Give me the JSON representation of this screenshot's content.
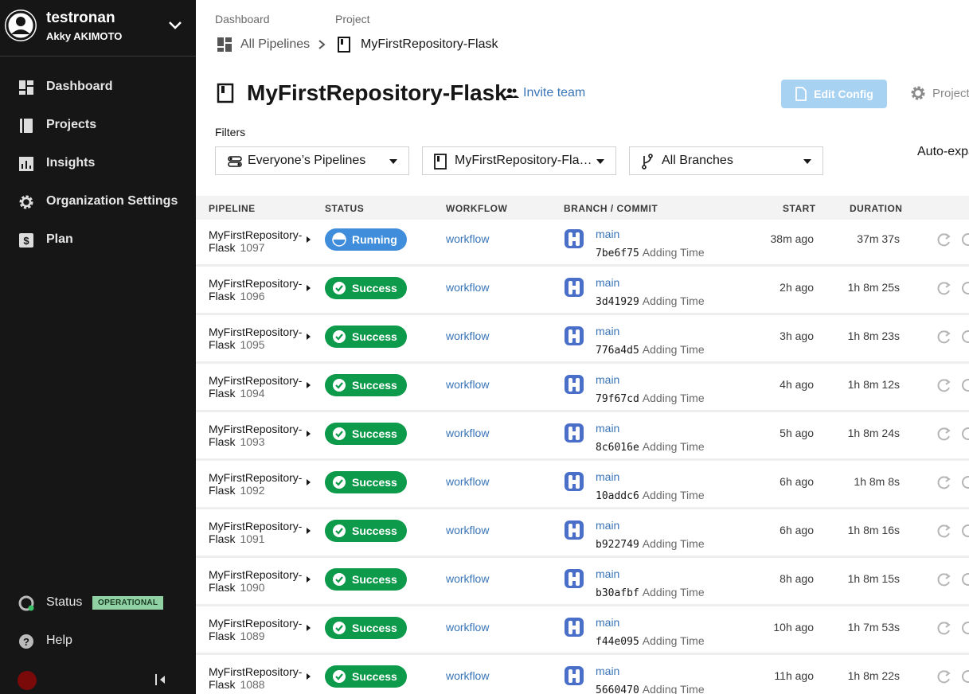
{
  "org": {
    "name": "testronan",
    "user": "Akky AKIMOTO"
  },
  "nav": [
    {
      "label": "Dashboard",
      "icon": "dashboard-icon"
    },
    {
      "label": "Projects",
      "icon": "projects-icon"
    },
    {
      "label": "Insights",
      "icon": "insights-icon"
    },
    {
      "label": "Organization Settings",
      "icon": "gear-icon"
    },
    {
      "label": "Plan",
      "icon": "dollar-icon"
    }
  ],
  "status": {
    "label": "Status",
    "badge": "OPERATIONAL"
  },
  "help": {
    "label": "Help"
  },
  "breadcrumb": {
    "dashboard_label": "Dashboard",
    "project_label": "Project",
    "all_pipelines": "All Pipelines",
    "current": "MyFirstRepository-Flask"
  },
  "header": {
    "title": "MyFirstRepository-Flask",
    "invite": "Invite team",
    "edit_config": "Edit Config",
    "project_settings": "Project Settings"
  },
  "filters": {
    "label": "Filters",
    "pipelines": "Everyone’s Pipelines",
    "project": "MyFirstRepository-Fla…",
    "branches": "All Branches",
    "auto_expand": "Auto-expand"
  },
  "table": {
    "headers": {
      "pipeline": "PIPELINE",
      "status": "STATUS",
      "workflow": "WORKFLOW",
      "branch_commit": "BRANCH / COMMIT",
      "start": "START",
      "duration": "DURATION"
    },
    "rows": [
      {
        "name1": "MyFirstRepository-",
        "name2": "Flask",
        "num": "1097",
        "status": "Running",
        "workflow": "workflow",
        "branch": "main",
        "hash": "7be6f75",
        "msg": "Adding Time",
        "start": "38m ago",
        "duration": "37m 37s"
      },
      {
        "name1": "MyFirstRepository-",
        "name2": "Flask",
        "num": "1096",
        "status": "Success",
        "workflow": "workflow",
        "branch": "main",
        "hash": "3d41929",
        "msg": "Adding Time",
        "start": "2h ago",
        "duration": "1h 8m 25s"
      },
      {
        "name1": "MyFirstRepository-",
        "name2": "Flask",
        "num": "1095",
        "status": "Success",
        "workflow": "workflow",
        "branch": "main",
        "hash": "776a4d5",
        "msg": "Adding Time",
        "start": "3h ago",
        "duration": "1h 8m 23s"
      },
      {
        "name1": "MyFirstRepository-",
        "name2": "Flask",
        "num": "1094",
        "status": "Success",
        "workflow": "workflow",
        "branch": "main",
        "hash": "79f67cd",
        "msg": "Adding Time",
        "start": "4h ago",
        "duration": "1h 8m 12s"
      },
      {
        "name1": "MyFirstRepository-",
        "name2": "Flask",
        "num": "1093",
        "status": "Success",
        "workflow": "workflow",
        "branch": "main",
        "hash": "8c6016e",
        "msg": "Adding Time",
        "start": "5h ago",
        "duration": "1h 8m 24s"
      },
      {
        "name1": "MyFirstRepository-",
        "name2": "Flask",
        "num": "1092",
        "status": "Success",
        "workflow": "workflow",
        "branch": "main",
        "hash": "10addc6",
        "msg": "Adding Time",
        "start": "6h ago",
        "duration": "1h 8m 8s"
      },
      {
        "name1": "MyFirstRepository-",
        "name2": "Flask",
        "num": "1091",
        "status": "Success",
        "workflow": "workflow",
        "branch": "main",
        "hash": "b922749",
        "msg": "Adding Time",
        "start": "6h ago",
        "duration": "1h 8m 16s"
      },
      {
        "name1": "MyFirstRepository-",
        "name2": "Flask",
        "num": "1090",
        "status": "Success",
        "workflow": "workflow",
        "branch": "main",
        "hash": "b30afbf",
        "msg": "Adding Time",
        "start": "8h ago",
        "duration": "1h 8m 15s"
      },
      {
        "name1": "MyFirstRepository-",
        "name2": "Flask",
        "num": "1089",
        "status": "Success",
        "workflow": "workflow",
        "branch": "main",
        "hash": "f44e095",
        "msg": "Adding Time",
        "start": "10h ago",
        "duration": "1h 7m 53s"
      },
      {
        "name1": "MyFirstRepository-",
        "name2": "Flask",
        "num": "1088",
        "status": "Success",
        "workflow": "workflow",
        "branch": "main",
        "hash": "5660470",
        "msg": "Adding Time",
        "start": "11h ago",
        "duration": "1h 8m 22s"
      }
    ]
  },
  "colors": {
    "success": "#0e9a4b",
    "running": "#3f8ddb",
    "link": "#3a75b8",
    "sidebar": "#161616"
  }
}
